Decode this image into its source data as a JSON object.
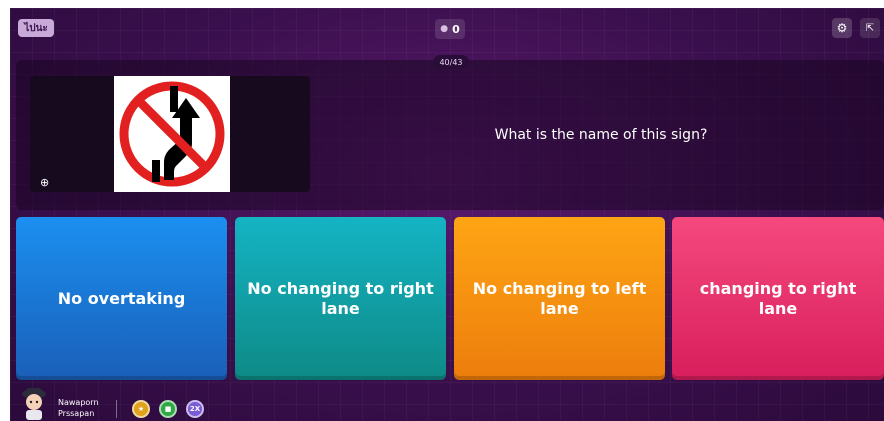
{
  "header": {
    "exit_label": "ไปนะ",
    "score": "0",
    "progress": "40/43"
  },
  "question": {
    "text": "What is the name of this sign?"
  },
  "answers": [
    {
      "label": "No overtaking",
      "color": "#1b8ff0"
    },
    {
      "label": "No changing to right lane",
      "color": "#14b4c4"
    },
    {
      "label": "No changing to left lane",
      "color": "#ffa514"
    },
    {
      "label": "changing to right lane",
      "color": "#f5497e"
    }
  ],
  "player": {
    "first_name": "Nawaporn",
    "last_name": "Prssapan"
  },
  "powerups": [
    {
      "icon": "coin-powerup-icon"
    },
    {
      "icon": "streak-powerup-icon"
    },
    {
      "icon": "double-points-powerup-icon",
      "label": "2X"
    }
  ],
  "icons": {
    "settings": "gear-icon",
    "fullscreen": "fullscreen-icon",
    "zoom": "zoom-in-icon",
    "score": "drop-icon"
  }
}
